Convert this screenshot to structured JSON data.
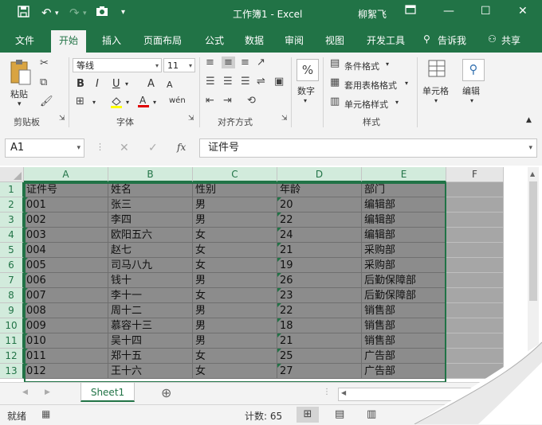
{
  "titlebar": {
    "title": "工作簿1 - Excel",
    "user": "柳絮飞",
    "accent": "#217346"
  },
  "tabs": [
    {
      "label": "文件"
    },
    {
      "label": "开始"
    },
    {
      "label": "插入"
    },
    {
      "label": "页面布局"
    },
    {
      "label": "公式"
    },
    {
      "label": "数据"
    },
    {
      "label": "审阅"
    },
    {
      "label": "视图"
    },
    {
      "label": "开发工具"
    },
    {
      "label": "告诉我"
    },
    {
      "label": "共享"
    }
  ],
  "ribbon": {
    "paste_label": "粘贴",
    "clipboard_label": "剪贴板",
    "font_name": "等线",
    "font_size": "11",
    "font_label": "字体",
    "align_label": "对齐方式",
    "number_label": "数字",
    "cond_format": "条件格式",
    "table_format": "套用表格格式",
    "cell_style": "单元格样式",
    "style_label": "样式",
    "cells_label": "单元格",
    "edit_label": "编辑",
    "bold": "B",
    "italic": "I",
    "underline": "U",
    "percent": "%",
    "grow_font": "A",
    "shrink_font": "A",
    "pinyin": "wén"
  },
  "formula_bar": {
    "name_box": "A1",
    "fx": "fx",
    "content": "证件号"
  },
  "grid": {
    "columns": [
      "A",
      "B",
      "C",
      "D",
      "E",
      "F"
    ],
    "rows": [
      "1",
      "2",
      "3",
      "4",
      "5",
      "6",
      "7",
      "8",
      "9",
      "10",
      "11",
      "12",
      "13"
    ],
    "data": [
      [
        "证件号",
        "姓名",
        "性别",
        "年龄",
        "部门"
      ],
      [
        "001",
        "张三",
        "男",
        "20",
        "编辑部"
      ],
      [
        "002",
        "李四",
        "男",
        "22",
        "编辑部"
      ],
      [
        "003",
        "欧阳五六",
        "女",
        "24",
        "编辑部"
      ],
      [
        "004",
        "赵七",
        "女",
        "21",
        "采购部"
      ],
      [
        "005",
        "司马八九",
        "女",
        "19",
        "采购部"
      ],
      [
        "006",
        "钱十",
        "男",
        "26",
        "后勤保障部"
      ],
      [
        "007",
        "李十一",
        "女",
        "23",
        "后勤保障部"
      ],
      [
        "008",
        "周十二",
        "男",
        "22",
        "销售部"
      ],
      [
        "009",
        "慕容十三",
        "男",
        "18",
        "销售部"
      ],
      [
        "010",
        "吴十四",
        "男",
        "21",
        "销售部"
      ],
      [
        "011",
        "郑十五",
        "女",
        "25",
        "广告部"
      ],
      [
        "012",
        "王十六",
        "女",
        "27",
        "广告部"
      ]
    ]
  },
  "sheets": {
    "active": "Sheet1",
    "add": "⊕"
  },
  "status": {
    "mode": "就绪",
    "count": "计数: 65"
  }
}
